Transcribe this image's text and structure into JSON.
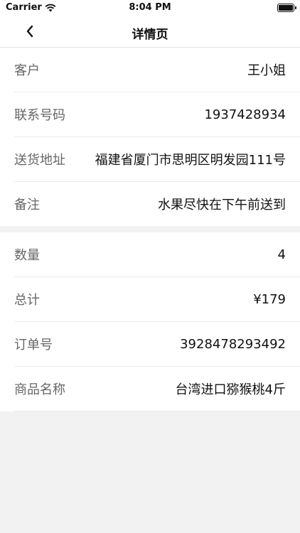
{
  "status_bar": {
    "carrier": "Carrier",
    "time": "8:04 PM"
  },
  "nav": {
    "title": "详情页"
  },
  "section1": [
    {
      "label": "客户",
      "value": "王小姐"
    },
    {
      "label": "联系号码",
      "value": "1937428934"
    },
    {
      "label": "送货地址",
      "value": "福建省厦门市思明区明发园111号"
    },
    {
      "label": "备注",
      "value": "水果尽快在下午前送到"
    }
  ],
  "section2": [
    {
      "label": "数量",
      "value": "4"
    },
    {
      "label": "总计",
      "value": "¥179"
    },
    {
      "label": "订单号",
      "value": "3928478293492"
    },
    {
      "label": "商品名称",
      "value": "台湾进口猕猴桃4斤"
    }
  ]
}
